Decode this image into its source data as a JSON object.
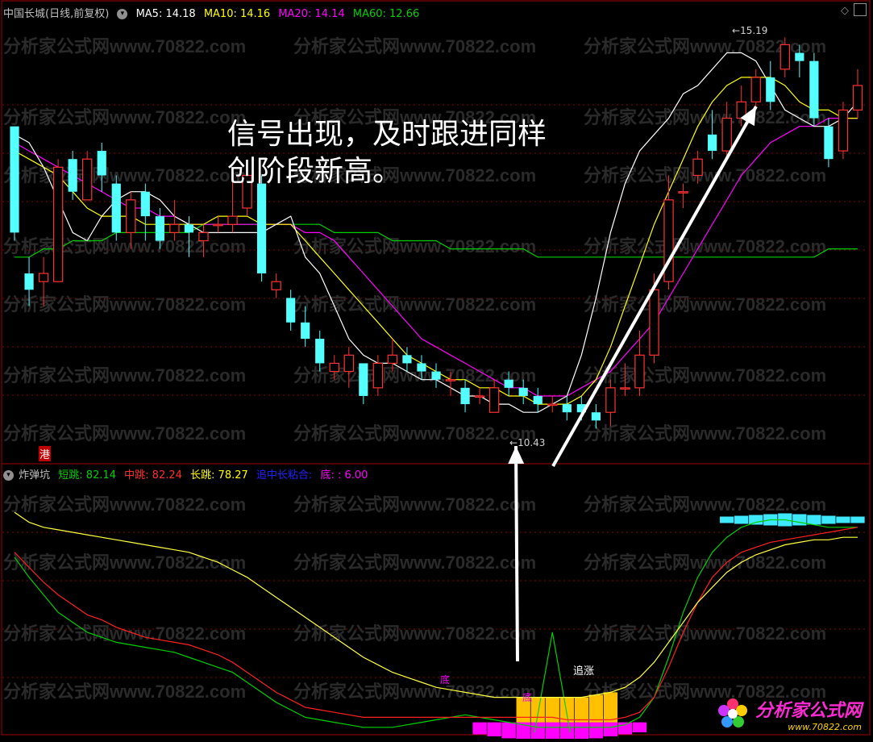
{
  "top_header": {
    "title": "中国长城(日线,前复权)",
    "ma5": "MA5: 14.18",
    "ma10": "MA10: 14.16",
    "ma20": "MA20: 14.14",
    "ma60": "MA60: 12.66"
  },
  "colors": {
    "up": "#ff3232",
    "down": "#54ffff",
    "ma5": "#ffffff",
    "ma10": "#ffff00",
    "ma20": "#ff00ff",
    "ma60": "#00d000",
    "grid": "#8b0000",
    "border": "#a00000",
    "annotation": "#ffffff"
  },
  "annotation": "信号出现，及时跟进同样\n创阶段新高。",
  "price_labels": {
    "high": "15.19",
    "low": "10.43"
  },
  "hk_badge": "港",
  "indicator_header": {
    "name": "炸弹坑",
    "short_label": "短跳: 82.14",
    "mid_label": "中跳: 82.24",
    "long_label": "长跳: 78.27",
    "chase_label": "追中长粘合:",
    "bottom_label": "底: : 6.00"
  },
  "indicator_marks": {
    "chase": "追涨",
    "bottom1": "底",
    "bottom2": "底"
  },
  "watermark": "分析家公式网www.70822.com",
  "brand": {
    "name": "分析家公式网",
    "url": "www.70822.com"
  },
  "chart_data": [
    {
      "type": "candlestick",
      "title": "中国长城(日线,前复权)",
      "ylim": [
        10.0,
        15.4
      ],
      "series": [
        {
          "name": "MA5",
          "values": [
            14.0,
            13.9,
            13.6,
            13.2,
            12.8,
            12.7,
            13.0,
            13.2,
            13.3,
            13.3,
            13.2,
            13.0,
            12.9,
            12.8,
            12.8,
            12.8,
            12.8,
            12.8,
            12.9,
            13.0,
            12.5,
            12.3,
            11.9,
            11.5,
            11.3,
            11.2,
            11.2,
            11.1,
            11.0,
            11.0,
            10.9,
            10.8,
            10.8,
            10.7,
            10.7,
            10.6,
            10.6,
            10.7,
            10.8,
            11.3,
            12.0,
            12.8,
            13.4,
            13.8,
            14.0,
            14.2,
            14.5,
            14.6,
            14.8,
            15.0,
            15.0,
            14.9,
            14.6,
            14.3,
            14.2,
            14.1,
            14.1,
            14.2,
            14.4
          ]
        },
        {
          "name": "MA10",
          "values": [
            13.8,
            13.7,
            13.6,
            13.5,
            13.3,
            13.1,
            13.0,
            13.0,
            13.0,
            12.9,
            12.9,
            12.9,
            12.9,
            12.9,
            13.0,
            13.0,
            13.0,
            12.9,
            12.9,
            12.9,
            12.7,
            12.5,
            12.3,
            12.1,
            11.9,
            11.7,
            11.5,
            11.3,
            11.2,
            11.1,
            11.0,
            11.0,
            10.9,
            10.9,
            10.8,
            10.8,
            10.7,
            10.7,
            10.7,
            10.8,
            11.0,
            11.4,
            11.9,
            12.4,
            12.9,
            13.3,
            13.7,
            14.1,
            14.4,
            14.6,
            14.7,
            14.7,
            14.7,
            14.6,
            14.4,
            14.3,
            14.3,
            14.2,
            14.2
          ]
        },
        {
          "name": "MA20",
          "values": [
            13.9,
            13.8,
            13.7,
            13.6,
            13.5,
            13.4,
            13.3,
            13.2,
            13.1,
            13.1,
            13.0,
            13.0,
            12.9,
            12.9,
            12.9,
            12.9,
            12.9,
            12.9,
            12.9,
            12.9,
            12.8,
            12.8,
            12.7,
            12.5,
            12.3,
            12.1,
            11.9,
            11.7,
            11.5,
            11.4,
            11.3,
            11.2,
            11.1,
            11.0,
            10.9,
            10.9,
            10.8,
            10.8,
            10.8,
            10.9,
            11.0,
            11.1,
            11.3,
            11.5,
            11.7,
            12.0,
            12.3,
            12.6,
            12.9,
            13.2,
            13.5,
            13.7,
            13.9,
            14.0,
            14.1,
            14.1,
            14.2,
            14.2,
            14.2
          ]
        },
        {
          "name": "MA60",
          "values": [
            12.5,
            12.5,
            12.6,
            12.6,
            12.7,
            12.7,
            12.7,
            12.8,
            12.8,
            12.8,
            12.8,
            12.8,
            12.8,
            12.9,
            12.9,
            12.9,
            12.9,
            12.9,
            12.9,
            12.9,
            12.9,
            12.9,
            12.8,
            12.8,
            12.8,
            12.8,
            12.7,
            12.7,
            12.7,
            12.7,
            12.6,
            12.6,
            12.6,
            12.6,
            12.6,
            12.6,
            12.5,
            12.5,
            12.5,
            12.5,
            12.5,
            12.5,
            12.5,
            12.5,
            12.5,
            12.5,
            12.5,
            12.5,
            12.5,
            12.5,
            12.5,
            12.5,
            12.5,
            12.5,
            12.5,
            12.5,
            12.6,
            12.6,
            12.6
          ]
        }
      ],
      "candles": [
        {
          "o": 14.1,
          "c": 12.8,
          "h": 14.1,
          "l": 12.7
        },
        {
          "o": 12.3,
          "c": 12.1,
          "h": 12.5,
          "l": 11.9
        },
        {
          "o": 12.2,
          "c": 12.3,
          "h": 12.5,
          "l": 11.9
        },
        {
          "o": 12.2,
          "c": 13.6,
          "h": 13.7,
          "l": 12.2
        },
        {
          "o": 13.7,
          "c": 13.3,
          "h": 13.8,
          "l": 13.2
        },
        {
          "o": 13.2,
          "c": 13.7,
          "h": 13.8,
          "l": 13.2
        },
        {
          "o": 13.8,
          "c": 13.5,
          "h": 13.9,
          "l": 13.3
        },
        {
          "o": 13.4,
          "c": 12.8,
          "h": 13.5,
          "l": 12.7
        },
        {
          "o": 12.8,
          "c": 13.2,
          "h": 13.3,
          "l": 12.6
        },
        {
          "o": 13.3,
          "c": 13.0,
          "h": 13.4,
          "l": 12.7
        },
        {
          "o": 13.0,
          "c": 12.7,
          "h": 13.1,
          "l": 12.6
        },
        {
          "o": 12.8,
          "c": 12.9,
          "h": 13.2,
          "l": 12.7
        },
        {
          "o": 12.9,
          "c": 12.8,
          "h": 13.0,
          "l": 12.5
        },
        {
          "o": 12.7,
          "c": 12.8,
          "h": 12.9,
          "l": 12.5
        },
        {
          "o": 12.9,
          "c": 12.9,
          "h": 13.0,
          "l": 12.8
        },
        {
          "o": 12.9,
          "c": 13.0,
          "h": 13.5,
          "l": 12.8
        },
        {
          "o": 13.1,
          "c": 13.5,
          "h": 13.6,
          "l": 13.0
        },
        {
          "o": 13.4,
          "c": 12.3,
          "h": 13.5,
          "l": 12.2
        },
        {
          "o": 12.1,
          "c": 12.2,
          "h": 12.3,
          "l": 12.0
        },
        {
          "o": 12.0,
          "c": 11.7,
          "h": 12.1,
          "l": 11.6
        },
        {
          "o": 11.7,
          "c": 11.5,
          "h": 11.9,
          "l": 11.4
        },
        {
          "o": 11.5,
          "c": 11.2,
          "h": 11.6,
          "l": 11.1
        },
        {
          "o": 11.1,
          "c": 11.2,
          "h": 11.3,
          "l": 11.0
        },
        {
          "o": 11.1,
          "c": 11.3,
          "h": 11.4,
          "l": 10.9
        },
        {
          "o": 11.2,
          "c": 10.8,
          "h": 11.2,
          "l": 10.7
        },
        {
          "o": 10.9,
          "c": 11.2,
          "h": 11.3,
          "l": 10.8
        },
        {
          "o": 11.2,
          "c": 11.3,
          "h": 11.5,
          "l": 11.1
        },
        {
          "o": 11.3,
          "c": 11.2,
          "h": 11.4,
          "l": 11.1
        },
        {
          "o": 11.2,
          "c": 11.1,
          "h": 11.3,
          "l": 11.0
        },
        {
          "o": 11.1,
          "c": 11.0,
          "h": 11.2,
          "l": 10.9
        },
        {
          "o": 11.0,
          "c": 11.0,
          "h": 11.1,
          "l": 10.8
        },
        {
          "o": 10.9,
          "c": 10.7,
          "h": 11.0,
          "l": 10.6
        },
        {
          "o": 10.8,
          "c": 10.8,
          "h": 10.9,
          "l": 10.7
        },
        {
          "o": 10.6,
          "c": 10.9,
          "h": 11.0,
          "l": 10.6
        },
        {
          "o": 11.0,
          "c": 10.9,
          "h": 11.1,
          "l": 10.8
        },
        {
          "o": 10.9,
          "c": 10.8,
          "h": 11.0,
          "l": 10.7
        },
        {
          "o": 10.8,
          "c": 10.7,
          "h": 10.9,
          "l": 10.6
        },
        {
          "o": 10.7,
          "c": 10.7,
          "h": 10.8,
          "l": 10.6
        },
        {
          "o": 10.7,
          "c": 10.6,
          "h": 10.8,
          "l": 10.5
        },
        {
          "o": 10.7,
          "c": 10.6,
          "h": 10.8,
          "l": 10.5
        },
        {
          "o": 10.6,
          "c": 10.5,
          "h": 10.7,
          "l": 10.4
        },
        {
          "o": 10.6,
          "c": 10.9,
          "h": 11.0,
          "l": 10.43
        },
        {
          "o": 10.9,
          "c": 10.9,
          "h": 11.2,
          "l": 10.8
        },
        {
          "o": 10.9,
          "c": 11.3,
          "h": 11.6,
          "l": 10.8
        },
        {
          "o": 11.3,
          "c": 12.1,
          "h": 12.3,
          "l": 11.2
        },
        {
          "o": 12.2,
          "c": 13.2,
          "h": 13.5,
          "l": 12.1
        },
        {
          "o": 13.3,
          "c": 13.3,
          "h": 13.4,
          "l": 13.1
        },
        {
          "o": 13.5,
          "c": 13.7,
          "h": 13.8,
          "l": 13.4
        },
        {
          "o": 14.0,
          "c": 13.8,
          "h": 14.3,
          "l": 13.7
        },
        {
          "o": 13.8,
          "c": 14.2,
          "h": 14.4,
          "l": 13.7
        },
        {
          "o": 14.2,
          "c": 14.4,
          "h": 14.6,
          "l": 14.1
        },
        {
          "o": 14.4,
          "c": 14.7,
          "h": 14.8,
          "l": 14.3
        },
        {
          "o": 14.7,
          "c": 14.4,
          "h": 14.9,
          "l": 14.3
        },
        {
          "o": 14.8,
          "c": 15.1,
          "h": 15.19,
          "l": 14.7
        },
        {
          "o": 15.0,
          "c": 14.9,
          "h": 15.1,
          "l": 14.7
        },
        {
          "o": 14.9,
          "c": 14.2,
          "h": 15.0,
          "l": 14.1
        },
        {
          "o": 14.1,
          "c": 13.7,
          "h": 14.2,
          "l": 13.6
        },
        {
          "o": 13.8,
          "c": 14.3,
          "h": 14.4,
          "l": 13.7
        },
        {
          "o": 14.3,
          "c": 14.6,
          "h": 14.8,
          "l": 14.2
        }
      ]
    },
    {
      "type": "line",
      "title": "炸弹坑",
      "ylim": [
        0,
        100
      ],
      "series": [
        {
          "name": "短跳",
          "values": [
            70,
            62,
            55,
            48,
            44,
            40,
            38,
            36,
            35,
            34,
            33,
            32,
            30,
            28,
            26,
            24,
            20,
            16,
            12,
            9,
            6,
            5,
            4,
            3,
            2,
            2,
            2,
            3,
            4,
            5,
            6,
            7,
            6,
            5,
            4,
            3,
            2,
            2,
            2,
            2,
            2,
            2,
            3,
            6,
            14,
            30,
            48,
            62,
            72,
            78,
            82,
            84,
            85,
            85,
            84,
            83,
            82,
            82,
            82
          ]
        },
        {
          "name": "中跳",
          "values": [
            72,
            66,
            60,
            55,
            51,
            47,
            45,
            42,
            40,
            38,
            37,
            36,
            35,
            33,
            31,
            28,
            24,
            20,
            16,
            13,
            10,
            9,
            8,
            7,
            6,
            6,
            6,
            6,
            6,
            6,
            6,
            6,
            6,
            6,
            6,
            6,
            6,
            6,
            5,
            5,
            5,
            5,
            6,
            8,
            14,
            26,
            40,
            52,
            62,
            68,
            72,
            74,
            76,
            77,
            78,
            79,
            80,
            81,
            82
          ]
        },
        {
          "name": "长跳",
          "values": [
            88,
            84,
            82,
            81,
            80,
            79,
            78,
            77,
            76,
            75,
            74,
            73,
            72,
            70,
            68,
            65,
            62,
            58,
            54,
            50,
            46,
            42,
            38,
            34,
            30,
            27,
            24,
            22,
            20,
            18,
            17,
            16,
            15,
            14,
            14,
            14,
            14,
            14,
            14,
            14,
            15,
            16,
            18,
            22,
            28,
            36,
            44,
            52,
            58,
            64,
            68,
            71,
            73,
            75,
            76,
            77,
            77,
            78,
            78
          ]
        }
      ],
      "annotations": [
        "追涨",
        "底",
        "底"
      ]
    }
  ]
}
